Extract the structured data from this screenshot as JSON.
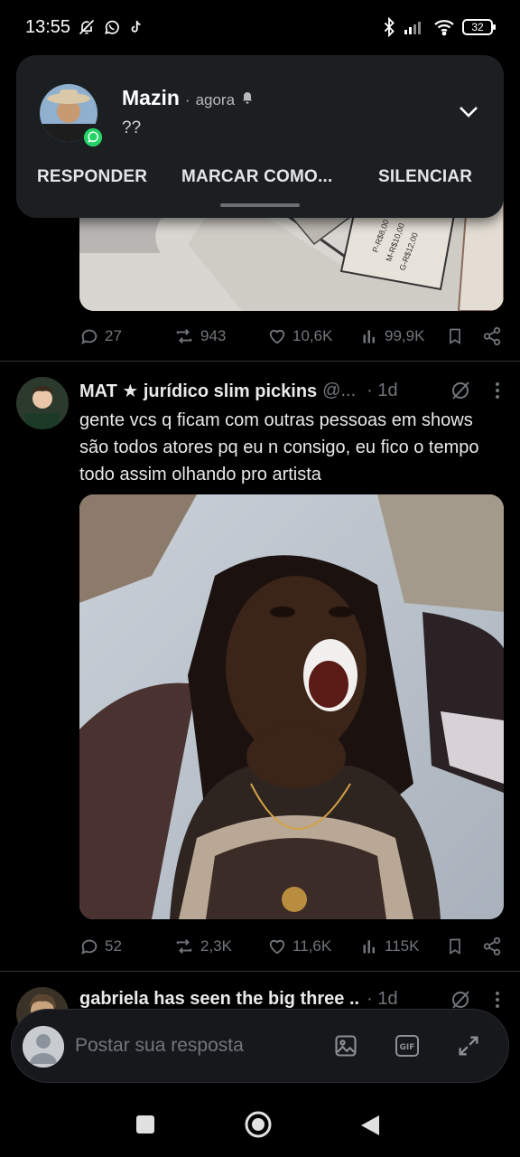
{
  "status_bar": {
    "time": "13:55",
    "battery": "32"
  },
  "notification": {
    "sender": "Mazin",
    "separator": "·",
    "time": "agora",
    "message": "??",
    "actions": {
      "reply": "RESPONDER",
      "mark": "MARCAR COMO...",
      "mute": "SILENCIAR"
    }
  },
  "tweets": [
    {
      "stats": {
        "replies": "27",
        "retweets": "943",
        "likes": "10,6K",
        "views": "99,9K"
      }
    },
    {
      "name": "MAT ★ jurídico slim pickins",
      "handle": "@...",
      "time": "· 1d",
      "text": "gente vcs q ficam com outras pessoas em shows são todos atores pq eu n consigo, eu fico o tempo todo assim olhando pro artista",
      "stats": {
        "replies": "52",
        "retweets": "2,3K",
        "likes": "11,6K",
        "views": "115K"
      }
    },
    {
      "name": "gabriela has seen the big three ..",
      "time": "· 1d"
    }
  ],
  "reply_bar": {
    "placeholder": "Postar sua resposta"
  },
  "colors": {
    "background": "#000000",
    "muted": "#71767b",
    "text": "#e7e9ea",
    "notification_bg": "#1c1f22"
  }
}
